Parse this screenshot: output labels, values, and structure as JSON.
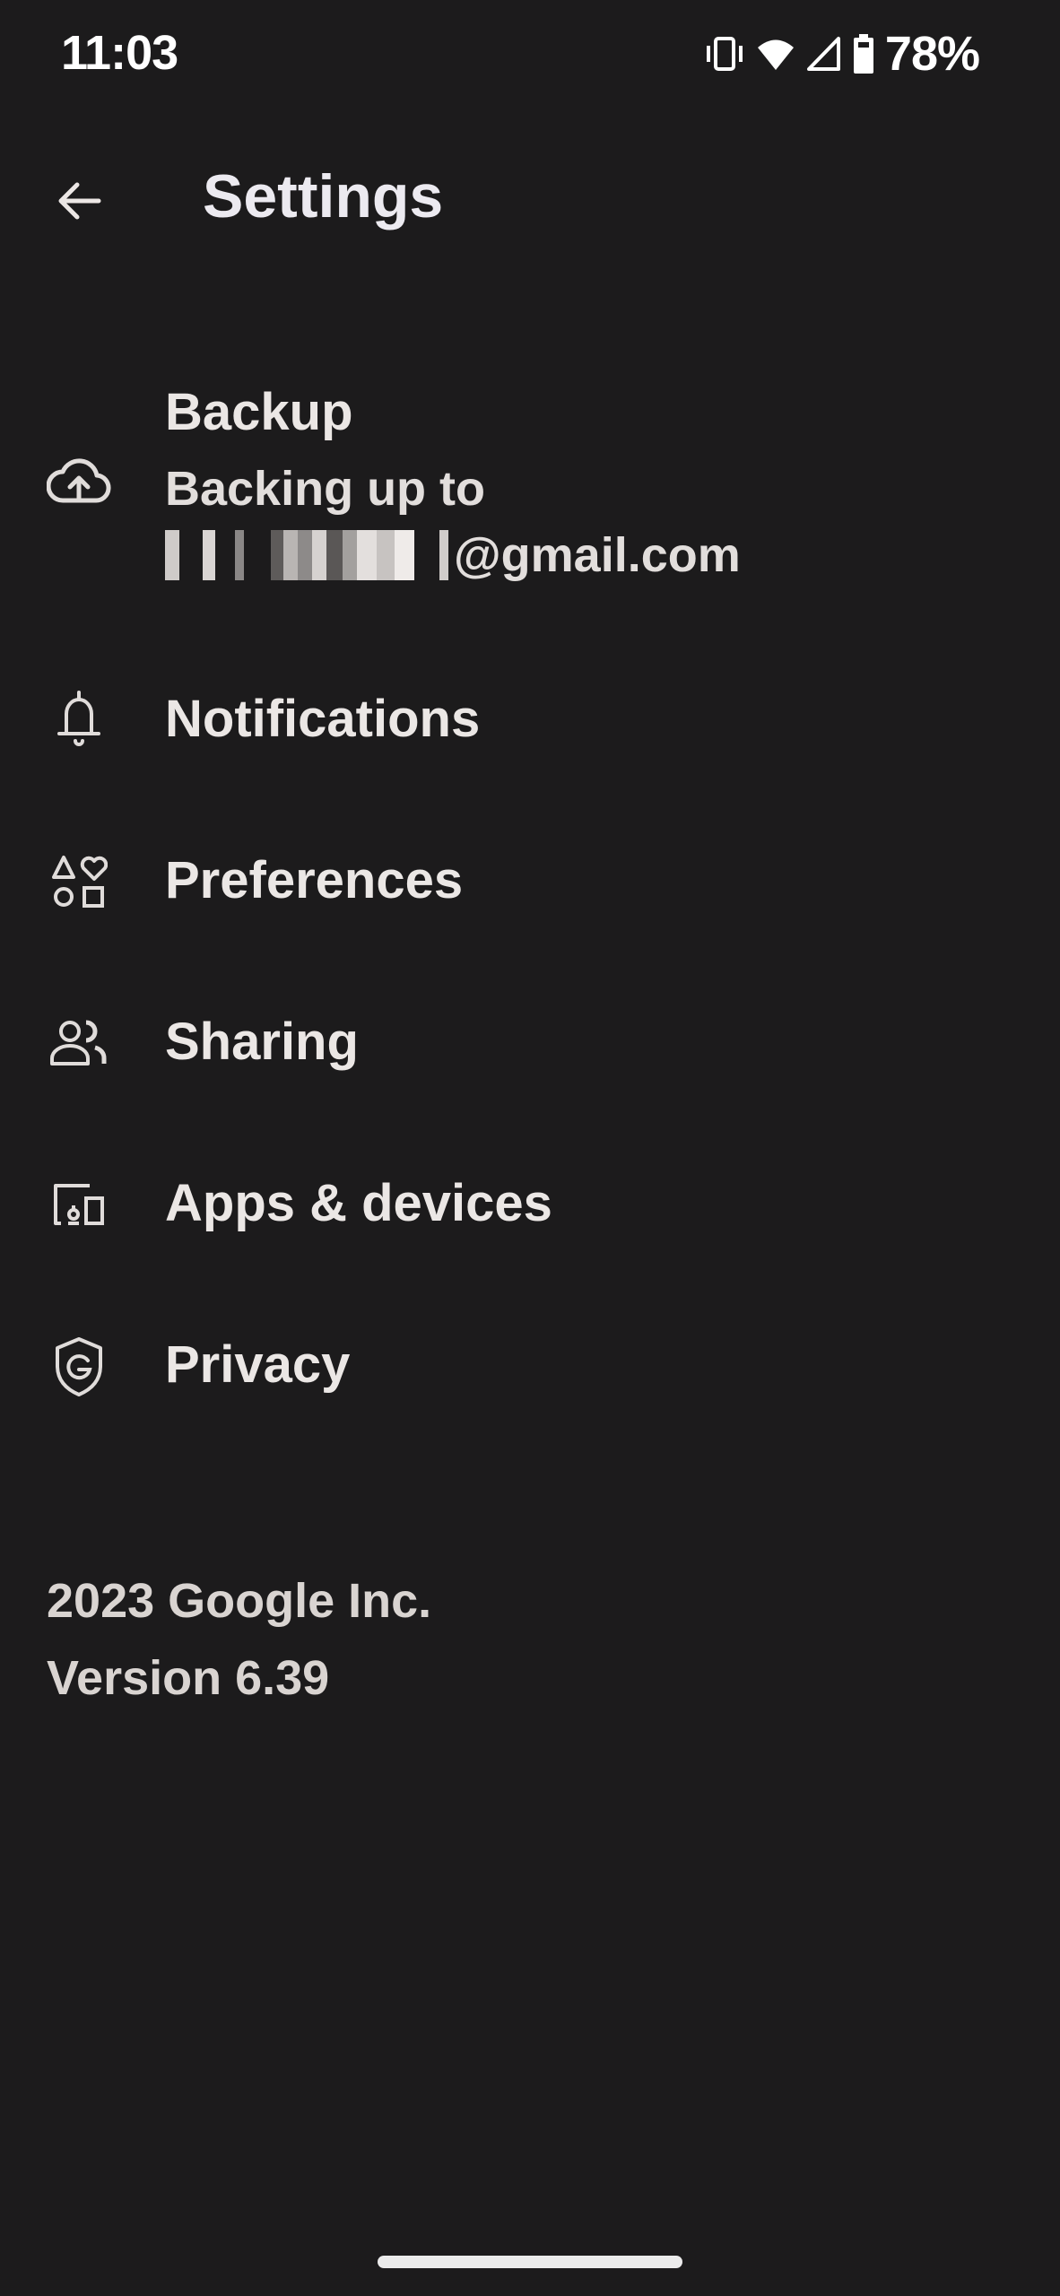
{
  "status_bar": {
    "time": "11:03",
    "icons": [
      "vibrate-icon",
      "wifi-icon",
      "cell-signal-icon",
      "battery-icon"
    ],
    "battery_percent": "78%"
  },
  "app_bar": {
    "back_icon": "arrow-back-icon",
    "title": "Settings"
  },
  "items": [
    {
      "icon": "cloud-upload-icon",
      "label": "Backup",
      "subtitle_line1": "Backing up to",
      "subtitle_line2_suffix": "@gmail.com",
      "subtitle_redacted": true
    },
    {
      "icon": "bell-icon",
      "label": "Notifications"
    },
    {
      "icon": "shapes-icon",
      "label": "Preferences"
    },
    {
      "icon": "people-icon",
      "label": "Sharing"
    },
    {
      "icon": "devices-icon",
      "label": "Apps & devices"
    },
    {
      "icon": "google-shield-icon",
      "label": "Privacy"
    }
  ],
  "footer": {
    "copyright": "2023 Google Inc.",
    "version": "Version 6.39"
  },
  "colors": {
    "background": "#1c1b1c",
    "text": "#ebe7e5",
    "icon": "#e0dcda"
  }
}
